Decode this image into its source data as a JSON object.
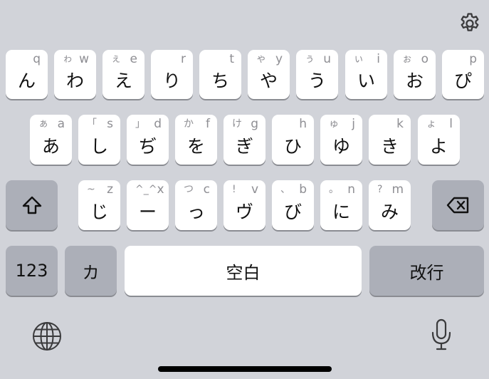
{
  "keyboard": {
    "row1": [
      {
        "main": "ん",
        "kana": "",
        "latin": "q"
      },
      {
        "main": "わ",
        "kana": "ゎ",
        "latin": "w"
      },
      {
        "main": "え",
        "kana": "ぇ",
        "latin": "e"
      },
      {
        "main": "り",
        "kana": "",
        "latin": "r"
      },
      {
        "main": "ち",
        "kana": "",
        "latin": "t"
      },
      {
        "main": "や",
        "kana": "ゃ",
        "latin": "y"
      },
      {
        "main": "う",
        "kana": "ぅ",
        "latin": "u"
      },
      {
        "main": "い",
        "kana": "ぃ",
        "latin": "i"
      },
      {
        "main": "お",
        "kana": "ぉ",
        "latin": "o"
      },
      {
        "main": "ぴ",
        "kana": "",
        "latin": "p"
      }
    ],
    "row2": [
      {
        "main": "あ",
        "kana": "ぁ",
        "latin": "a"
      },
      {
        "main": "し",
        "kana": "「",
        "latin": "s"
      },
      {
        "main": "ぢ",
        "kana": "」",
        "latin": "d"
      },
      {
        "main": "を",
        "kana": "か",
        "latin": "f"
      },
      {
        "main": "ぎ",
        "kana": "け",
        "latin": "g"
      },
      {
        "main": "ひ",
        "kana": "",
        "latin": "h"
      },
      {
        "main": "ゆ",
        "kana": "ゅ",
        "latin": "j"
      },
      {
        "main": "き",
        "kana": "",
        "latin": "k"
      },
      {
        "main": "よ",
        "kana": "ょ",
        "latin": "l"
      }
    ],
    "row3": [
      {
        "main": "じ",
        "kana": "~",
        "latin": "z"
      },
      {
        "main": "ー",
        "kana": "^_^",
        "latin": "x"
      },
      {
        "main": "っ",
        "kana": "つ",
        "latin": "c"
      },
      {
        "main": "ヴ",
        "kana": "!",
        "latin": "v"
      },
      {
        "main": "び",
        "kana": "、",
        "latin": "b"
      },
      {
        "main": "に",
        "kana": "。",
        "latin": "n"
      },
      {
        "main": "み",
        "kana": "?",
        "latin": "m"
      }
    ],
    "numbers_label": "123",
    "kana_toggle_label": "カ",
    "space_label": "空白",
    "return_label": "改行"
  },
  "icons": {
    "settings": "gear-icon",
    "shift": "shift-arrow-icon",
    "delete": "backspace-icon",
    "globe": "globe-icon",
    "mic": "microphone-icon"
  },
  "colors": {
    "background": "#d1d3d9",
    "key": "#ffffff",
    "function_key": "#acafb8",
    "hint_text": "#8e8e93"
  }
}
